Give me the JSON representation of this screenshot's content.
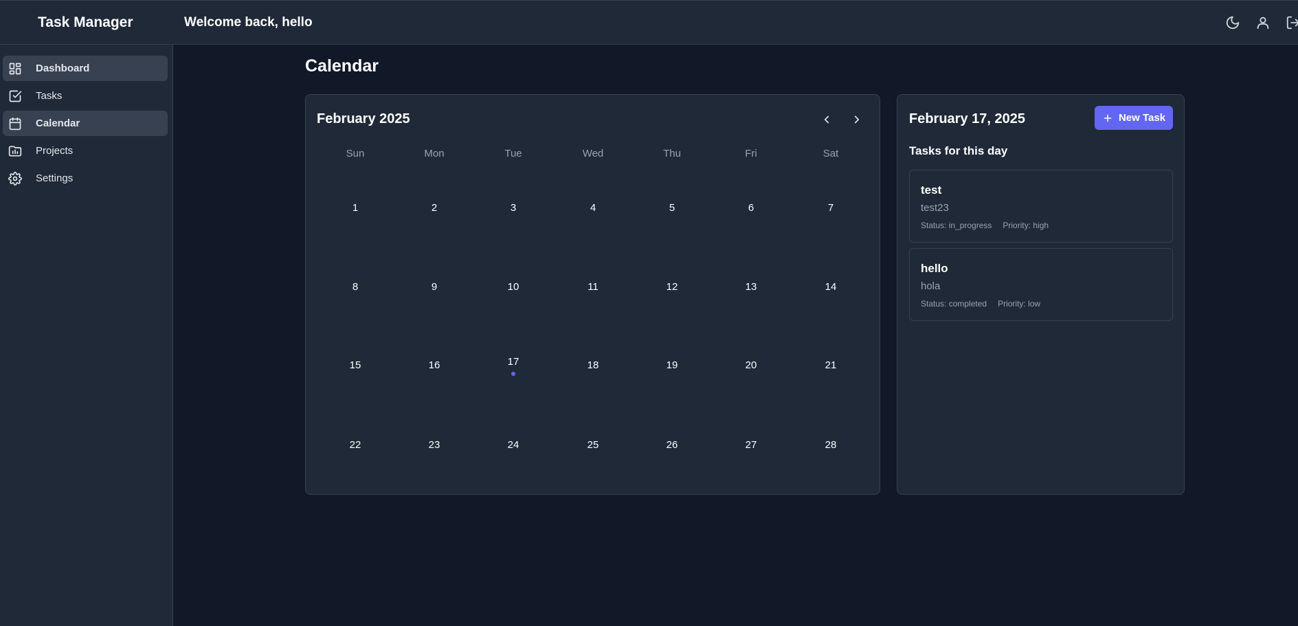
{
  "header": {
    "app_title": "Task Manager",
    "welcome": "Welcome back, hello",
    "icons": [
      "moon-icon",
      "user-icon",
      "logout-icon"
    ]
  },
  "sidebar": {
    "items": [
      {
        "label": "Dashboard",
        "icon": "dashboard-icon",
        "active": true
      },
      {
        "label": "Tasks",
        "icon": "check-square-icon",
        "active": false
      },
      {
        "label": "Calendar",
        "icon": "calendar-icon",
        "active": true
      },
      {
        "label": "Projects",
        "icon": "folder-chart-icon",
        "active": false
      },
      {
        "label": "Settings",
        "icon": "gear-icon",
        "active": false
      }
    ]
  },
  "page": {
    "title": "Calendar"
  },
  "calendar": {
    "month_label": "February 2025",
    "weekdays": [
      "Sun",
      "Mon",
      "Tue",
      "Wed",
      "Thu",
      "Fri",
      "Sat"
    ],
    "weeks": [
      [
        "1",
        "2",
        "3",
        "4",
        "5",
        "6",
        "7"
      ],
      [
        "8",
        "9",
        "10",
        "11",
        "12",
        "13",
        "14"
      ],
      [
        "15",
        "16",
        "17",
        "18",
        "19",
        "20",
        "21"
      ],
      [
        "22",
        "23",
        "24",
        "25",
        "26",
        "27",
        "28"
      ]
    ],
    "days_with_tasks": [
      "17"
    ]
  },
  "day_panel": {
    "date_label": "February 17, 2025",
    "new_task_label": "New Task",
    "tasks_heading": "Tasks for this day",
    "tasks": [
      {
        "title": "test",
        "description": "test23",
        "status": "Status: in_progress",
        "priority": "Priority: high"
      },
      {
        "title": "hello",
        "description": "hola",
        "status": "Status: completed",
        "priority": "Priority: low"
      }
    ]
  },
  "colors": {
    "background": "#111827",
    "panel": "#1f2937",
    "border": "#374151",
    "accent": "#6366f1",
    "muted_text": "#9ca3af"
  }
}
